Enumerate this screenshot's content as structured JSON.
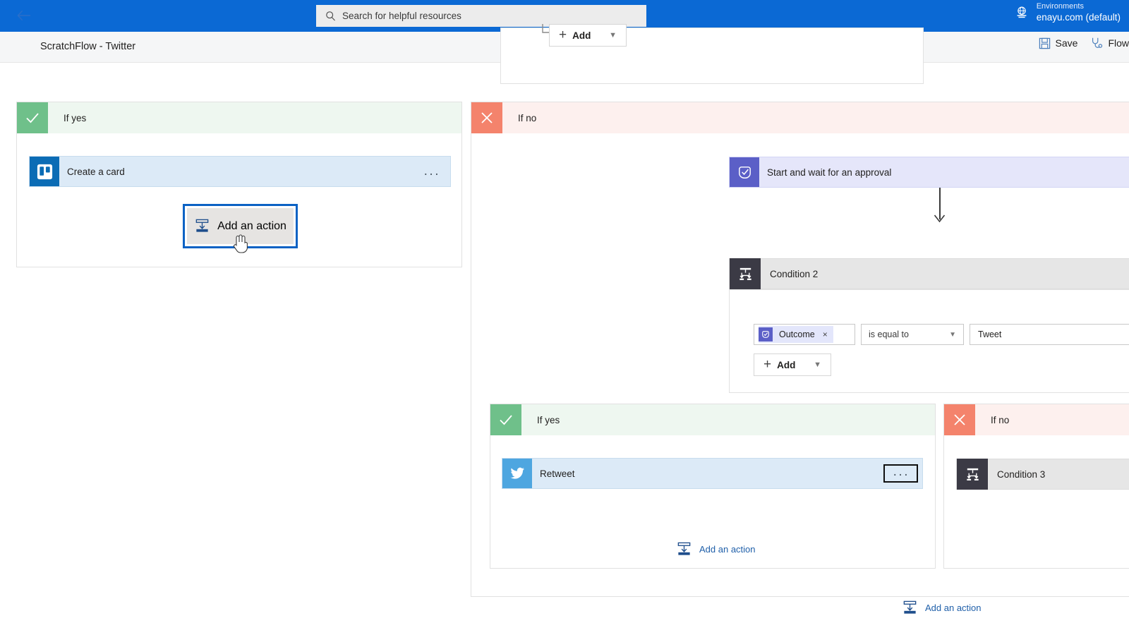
{
  "topbar": {
    "search": {
      "placeholder": "Search for helpful resources",
      "icon": "search-icon"
    },
    "environment": {
      "icon": "globe-environment-icon",
      "label": "Environments",
      "value": "enayu.com (default)"
    },
    "background_color": "#0b69d4"
  },
  "commandbar": {
    "back_icon": "back-arrow-icon",
    "flow_title": "ScratchFlow - Twitter",
    "actions": [
      {
        "name": "save",
        "label": "Save",
        "icon": "save-disk-icon"
      },
      {
        "name": "flow-checker",
        "label": "Flow",
        "icon": "stethoscope-icon"
      }
    ]
  },
  "canvas": {
    "top_partial_card": {
      "add_button": {
        "label": "Add",
        "plus": "+",
        "chevron": "chevron-down-icon"
      }
    },
    "left_branch": {
      "header": {
        "label": "If yes",
        "state": "yes",
        "icon": "checkmark-icon",
        "chip_color": "#6fc08a"
      },
      "action": {
        "title": "Create a card",
        "icon": "trello-icon",
        "icon_color": "#0b6cb5",
        "menu": "..."
      },
      "add_action": {
        "label": "Add an action",
        "icon": "add-action-icon",
        "focused": true
      }
    },
    "right_branch": {
      "header": {
        "label": "If no",
        "state": "no",
        "icon": "close-x-icon",
        "chip_color": "#f4836c"
      },
      "approval_action": {
        "title": "Start and wait for an approval",
        "icon": "approvals-icon",
        "icon_color": "#5b5fc7"
      },
      "condition": {
        "title": "Condition 2",
        "icon": "condition-icon",
        "icon_color": "#3b3a45",
        "row": {
          "token": {
            "label": "Outcome",
            "icon": "approvals-icon",
            "remove": "×"
          },
          "operator": {
            "value": "is equal to",
            "chevron": "chevron-down-icon"
          },
          "value": "Tweet"
        },
        "add_button": {
          "label": "Add",
          "plus": "+",
          "chevron": "chevron-down-icon"
        }
      },
      "nested_yes": {
        "header": {
          "label": "If yes",
          "state": "yes",
          "icon": "checkmark-icon",
          "chip_color": "#6fc08a"
        },
        "action": {
          "title": "Retweet",
          "icon": "twitter-icon",
          "icon_color": "#4ea6e0",
          "menu": "...",
          "menu_focused": true
        },
        "add_action": {
          "label": "Add an action",
          "icon": "add-action-icon"
        }
      },
      "nested_no": {
        "header": {
          "label": "If no",
          "state": "no",
          "icon": "close-x-icon",
          "chip_color": "#f4836c"
        },
        "condition": {
          "title": "Condition 3",
          "icon": "condition-icon",
          "icon_color": "#3b3a45"
        }
      },
      "add_action": {
        "label": "Add an action",
        "icon": "add-action-icon"
      }
    }
  }
}
